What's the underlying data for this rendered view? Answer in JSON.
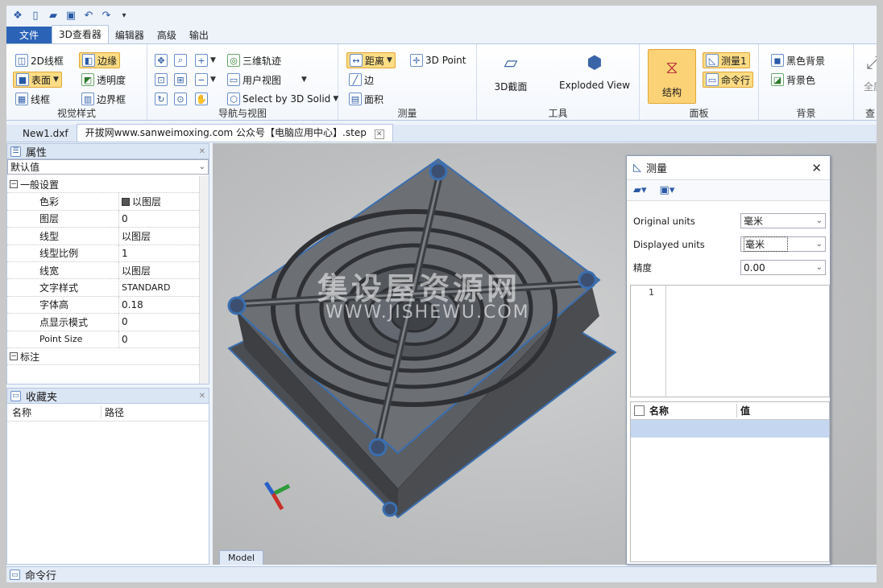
{
  "ribbon_tabs": [
    "文件",
    "3D查看器",
    "编辑器",
    "高级",
    "输出"
  ],
  "groups": {
    "visual_style": {
      "label": "视觉样式",
      "wire2d": "2D线框",
      "edge": "边缘",
      "surface": "表面",
      "transparency": "透明度",
      "wireframe": "线框",
      "bbox": "边界框"
    },
    "nav": {
      "label": "导航与视图",
      "orbit": "三维轨迹",
      "user_view": "用户视图",
      "select_solid": "Select by 3D Solid"
    },
    "measure": {
      "label": "测量",
      "distance": "距离",
      "point3d": "3D Point",
      "edge": "边",
      "area": "面积"
    },
    "tools": {
      "label": "工具",
      "section3d": "3D截面",
      "exploded": "Exploded View"
    },
    "panel": {
      "label": "面板",
      "structure": "结构",
      "measure1": "测量1",
      "cmdline": "命令行"
    },
    "background": {
      "label": "背景",
      "black_bg": "黑色背景",
      "bg_color": "背景色"
    },
    "extra": {
      "fullscreen": "全屏",
      "view": "查"
    }
  },
  "doc_tabs": [
    "New1.dxf",
    "开拔网www.sanweimoxing.com 公众号【电脑应用中心】.step"
  ],
  "properties": {
    "title": "属性",
    "selector": "默认值",
    "section_general": "一般设置",
    "section_annot": "标注",
    "rows": [
      {
        "k": "色彩",
        "v": "以图层"
      },
      {
        "k": "图层",
        "v": "0"
      },
      {
        "k": "线型",
        "v": "以图层"
      },
      {
        "k": "线型比例",
        "v": "1"
      },
      {
        "k": "线宽",
        "v": "以图层"
      },
      {
        "k": "文字样式",
        "v": "STANDARD"
      },
      {
        "k": "字体高",
        "v": "0.18"
      },
      {
        "k": "点显示模式",
        "v": "0"
      },
      {
        "k": "Point Size",
        "v": "0"
      }
    ]
  },
  "favorites": {
    "title": "收藏夹",
    "col_name": "名称",
    "col_path": "路径"
  },
  "viewport": {
    "model_tab": "Model",
    "watermark_cn": "集设屋资源网",
    "watermark_en": "WWW.JISHEWU.COM"
  },
  "measure_dialog": {
    "title": "测量",
    "original_units_label": "Original units",
    "original_units": "毫米",
    "displayed_units_label": "Displayed units",
    "displayed_units": "毫米",
    "precision_label": "精度",
    "precision": "0.00",
    "line_no": "1",
    "col_name": "名称",
    "col_value": "值"
  },
  "cmdline": {
    "label": "命令行"
  },
  "colors": {
    "accent": "#2b63b7",
    "highlight": "#fcdc84",
    "selected_row": "#c5d7f0"
  }
}
